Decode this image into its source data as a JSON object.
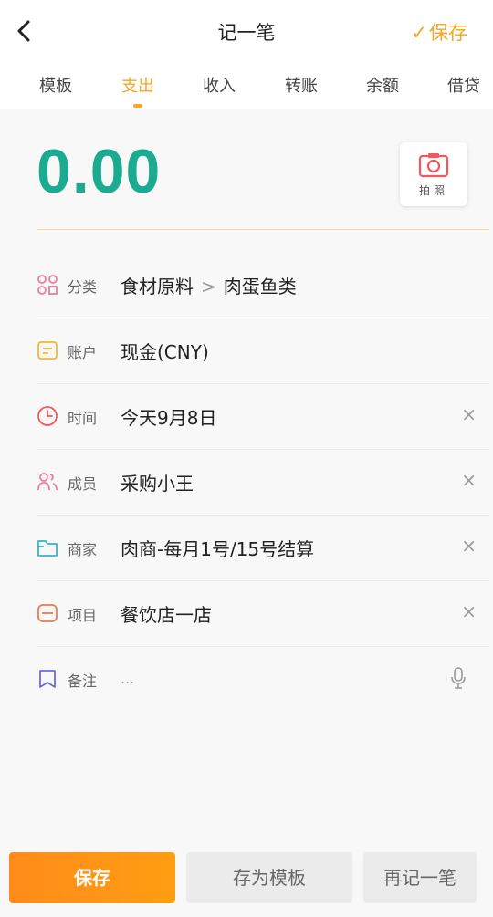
{
  "header": {
    "back_icon": "chevron-left-icon",
    "title": "记一笔",
    "save_check": "✓",
    "save_label": "保存",
    "accent_color": "#f5a623"
  },
  "tabs": [
    {
      "label": "模板",
      "active": false
    },
    {
      "label": "支出",
      "active": true
    },
    {
      "label": "收入",
      "active": false
    },
    {
      "label": "转账",
      "active": false
    },
    {
      "label": "余额",
      "active": false
    },
    {
      "label": "借贷",
      "active": false
    }
  ],
  "amount": {
    "value": "0.00",
    "color": "#1bab90",
    "photo_label": "拍照",
    "photo_icon": "camera-icon"
  },
  "fields": {
    "category": {
      "label": "分类",
      "icon": "category-icon",
      "value_main": "食材原料",
      "separator": ">",
      "value_sub": "肉蛋鱼类"
    },
    "account": {
      "label": "账户",
      "icon": "wallet-icon",
      "value": "现金(CNY)"
    },
    "time": {
      "label": "时间",
      "icon": "clock-icon",
      "value": "今天9月8日",
      "clear": "×"
    },
    "member": {
      "label": "成员",
      "icon": "members-icon",
      "value": "采购小王",
      "clear": "×"
    },
    "merchant": {
      "label": "商家",
      "icon": "merchant-icon",
      "value": "肉商-每月1号/15号结算",
      "clear": "×"
    },
    "project": {
      "label": "项目",
      "icon": "project-icon",
      "value": "餐饮店一店",
      "clear": "×"
    },
    "note": {
      "label": "备注",
      "icon": "note-icon",
      "placeholder": "...",
      "mic_icon": "microphone-icon"
    }
  },
  "footer": {
    "save_label": "保存",
    "save_template_label": "存为模板",
    "again_label": "再记一笔"
  }
}
